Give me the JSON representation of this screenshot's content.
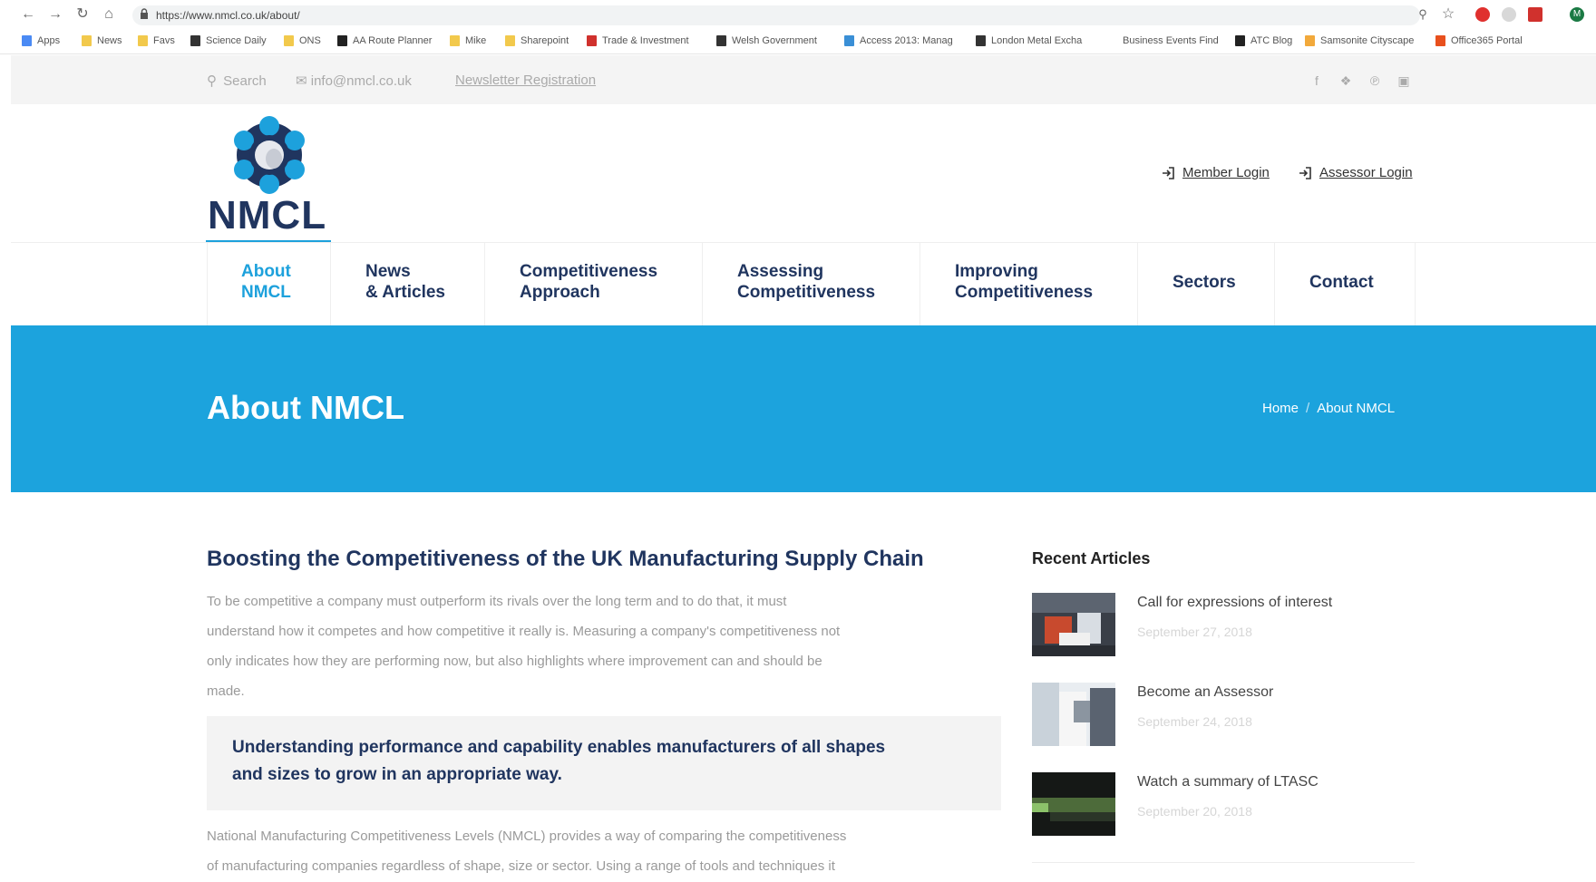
{
  "browser": {
    "url": "https://www.nmcl.co.uk/about/",
    "bookmarks": [
      {
        "label": "Apps",
        "icon": "apps-grid-icon",
        "color": "#4a8af4"
      },
      {
        "label": "News",
        "icon": "folder-icon",
        "color": "#f2c94c"
      },
      {
        "label": "Favs",
        "icon": "folder-icon",
        "color": "#f2c94c"
      },
      {
        "label": "Science Daily",
        "icon": "sd-icon",
        "color": "#333333"
      },
      {
        "label": "ONS",
        "icon": "folder-icon",
        "color": "#f2c94c"
      },
      {
        "label": "AA Route Planner",
        "icon": "aa-icon",
        "color": "#222222"
      },
      {
        "label": "Mike",
        "icon": "folder-icon",
        "color": "#f2c94c"
      },
      {
        "label": "Sharepoint",
        "icon": "folder-icon",
        "color": "#f2c94c"
      },
      {
        "label": "Trade & Investment",
        "icon": "dragon-icon",
        "color": "#d0312d"
      },
      {
        "label": "Welsh Government",
        "icon": "wg-icon",
        "color": "#333333"
      },
      {
        "label": "Access 2013: Manag",
        "icon": "globe-icon",
        "color": "#3a8fd6"
      },
      {
        "label": "London Metal Excha",
        "icon": "lme-icon",
        "color": "#333333"
      },
      {
        "label": "Business Events Find",
        "icon": "",
        "color": "#ffffff"
      },
      {
        "label": "ATC Blog",
        "icon": "atc-icon",
        "color": "#222222"
      },
      {
        "label": "Samsonite Cityscape",
        "icon": "samsonite-icon",
        "color": "#f2a93b"
      },
      {
        "label": "Office365 Portal",
        "icon": "office-icon",
        "color": "#e8501d"
      }
    ],
    "profile_initial": "M"
  },
  "topbar": {
    "search_label": "Search",
    "email": "info@nmcl.co.uk",
    "newsletter": "Newsletter Registration",
    "social": [
      "facebook-icon",
      "twitter-icon",
      "pinterest-icon",
      "instagram-icon"
    ]
  },
  "header": {
    "logo_text": "NMCL",
    "member_login": "Member Login",
    "assessor_login": "Assessor Login"
  },
  "nav": {
    "items": [
      {
        "line1": "About",
        "line2": "NMCL",
        "active": true
      },
      {
        "line1": "News",
        "line2": "& Articles",
        "active": false
      },
      {
        "line1": "Competitiveness",
        "line2": "Approach",
        "active": false
      },
      {
        "line1": "Assessing",
        "line2": "Competitiveness",
        "active": false
      },
      {
        "line1": "Improving",
        "line2": "Competitiveness",
        "active": false
      },
      {
        "line1": "Sectors",
        "line2": "",
        "active": false
      },
      {
        "line1": "Contact",
        "line2": "",
        "active": false
      }
    ]
  },
  "hero": {
    "title": "About NMCL",
    "breadcrumb_home": "Home",
    "breadcrumb_current": "About NMCL"
  },
  "content": {
    "heading": "Boosting the Competitiveness of the UK Manufacturing Supply Chain",
    "paragraph1_lines": [
      "To be competitive a company must outperform its rivals over the long term and to do that, it must",
      "understand how it competes and how competitive it really is. Measuring a company's competitiveness not",
      "only indicates how they are performing now, but also highlights where improvement can and should be",
      "made."
    ],
    "quote_lines": [
      "Understanding performance and capability enables manufacturers of all shapes",
      "and sizes to grow in an appropriate way."
    ],
    "paragraph2_lines": [
      "National Manufacturing Competitiveness Levels (NMCL) provides a way of comparing the competitiveness",
      "of manufacturing companies regardless of shape, size or sector. Using a range of tools and techniques it"
    ]
  },
  "sidebar": {
    "title": "Recent Articles",
    "articles": [
      {
        "title": "Call for expressions of interest",
        "date": "September 27, 2018"
      },
      {
        "title": "Become an Assessor",
        "date": "September 24, 2018"
      },
      {
        "title": "Watch a summary of LTASC",
        "date": "September 20, 2018"
      }
    ]
  },
  "colors": {
    "brand_blue": "#1ca3dd",
    "navy": "#20355f"
  }
}
